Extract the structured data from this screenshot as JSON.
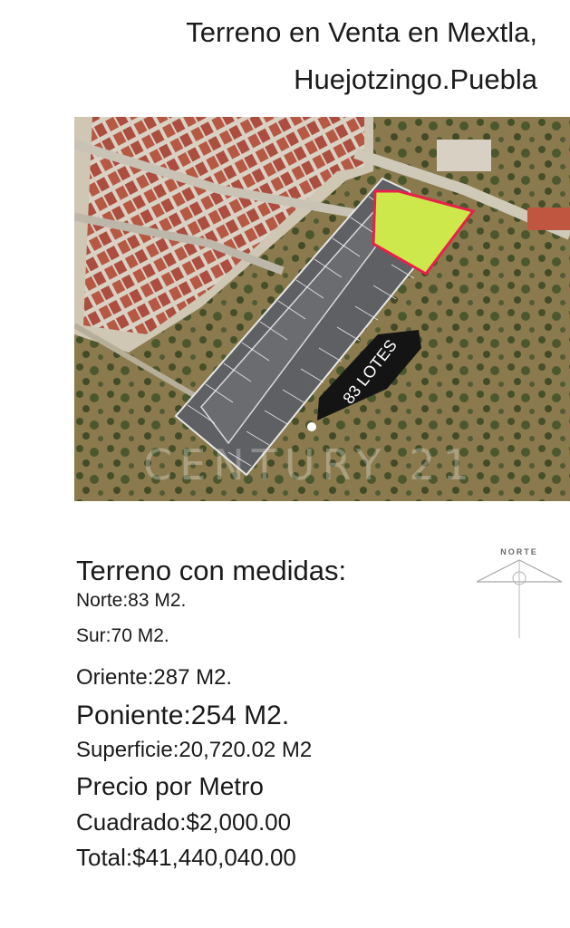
{
  "header": {
    "title_line_1": "Terreno en Venta en Mextla,",
    "title_line_2": "Huejotzingo.Puebla"
  },
  "map": {
    "lots_label": "83 LOTES",
    "watermark": "CENTURY 21",
    "colors": {
      "parcel_fill": "#cde84a",
      "parcel_border": "#e8204a",
      "lot_road": "#6e6e70",
      "label_bg": "#141414"
    }
  },
  "compass": {
    "label": "NORTE"
  },
  "specs": {
    "heading": "Terreno con medidas:",
    "norte": "Norte:83 M2.",
    "sur": "Sur:70 M2.",
    "oriente": "Oriente:287 M2.",
    "poniente": "Poniente:254 M2.",
    "superficie": "Superficie:20,720.02 M2",
    "precio_line_1": "Precio por Metro",
    "precio_line_2": "Cuadrado:$2,000.00",
    "total": "Total:$41,440,040.00"
  }
}
